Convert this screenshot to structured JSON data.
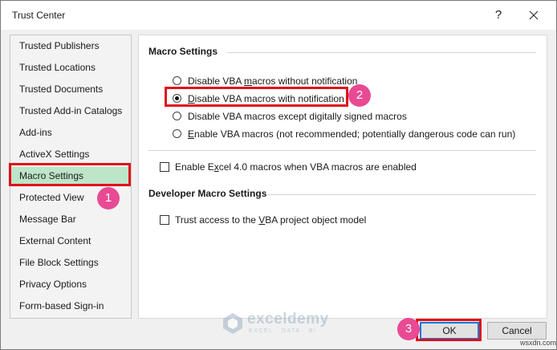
{
  "window": {
    "title": "Trust Center",
    "help_glyph": "?"
  },
  "sidebar": {
    "selected_index": 6,
    "items": [
      {
        "label": "Trusted Publishers"
      },
      {
        "label": "Trusted Locations"
      },
      {
        "label": "Trusted Documents"
      },
      {
        "label": "Trusted Add-in Catalogs"
      },
      {
        "label": "Add-ins"
      },
      {
        "label": "ActiveX Settings"
      },
      {
        "label": "Macro Settings"
      },
      {
        "label": "Protected View"
      },
      {
        "label": "Message Bar"
      },
      {
        "label": "External Content"
      },
      {
        "label": "File Block Settings"
      },
      {
        "label": "Privacy Options"
      },
      {
        "label": "Form-based Sign-in"
      }
    ]
  },
  "macro_settings": {
    "title": "Macro Settings",
    "selected_index": 1,
    "options": [
      {
        "pre": "Disable VBA ",
        "key": "m",
        "post": "acros without notification"
      },
      {
        "pre": "",
        "key": "D",
        "post": "isable VBA macros with notification"
      },
      {
        "pre": "Disable VBA macros except di",
        "key": "g",
        "post": "itally signed macros"
      },
      {
        "pre": "",
        "key": "E",
        "post": "nable VBA macros (not recommended; potentially dangerous code can run)"
      }
    ],
    "excel4": {
      "pre": "Enable E",
      "key": "x",
      "post": "cel 4.0 macros when VBA macros are enabled",
      "checked": false
    }
  },
  "developer_settings": {
    "title": "Developer Macro Settings",
    "vba_access": {
      "pre": "Trust access to the ",
      "key": "V",
      "post": "BA project object model",
      "checked": false
    }
  },
  "buttons": {
    "ok": "OK",
    "cancel": "Cancel"
  },
  "annotations": {
    "step1": "1",
    "step2": "2",
    "step3": "3",
    "color": "#e84a93",
    "highlight_color": "#e0101a"
  },
  "watermark": {
    "name": "exceldemy",
    "tagline": "EXCEL · DATA · BI"
  },
  "site_mark": "wsxdn.com",
  "colors": {
    "selected_nav": "#bde5c8",
    "ok_border": "#0078d7"
  }
}
